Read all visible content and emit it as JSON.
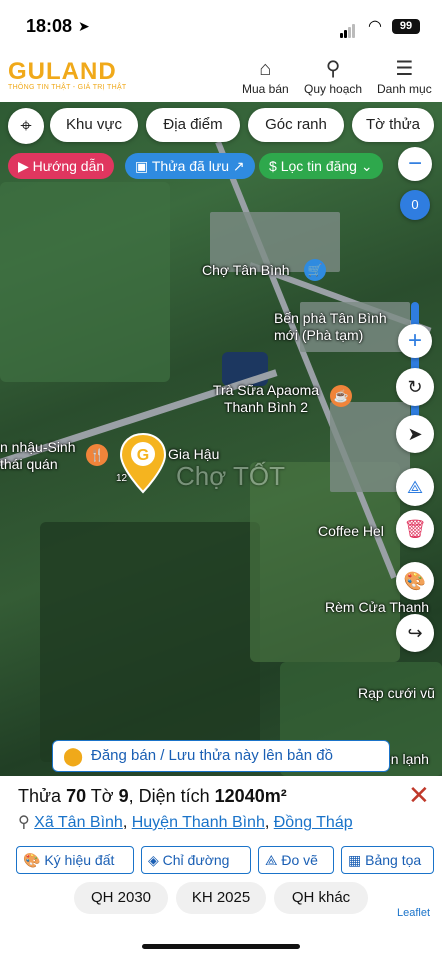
{
  "status_bar": {
    "time": "18:08",
    "battery": "99"
  },
  "header": {
    "logo_text": "GULAND",
    "logo_tagline": "THÔNG TIN THẬT - GIÁ TRỊ THẬT",
    "nav": [
      {
        "label": "Mua bán",
        "icon": "store-icon"
      },
      {
        "label": "Quy hoạch",
        "icon": "map-search-icon"
      },
      {
        "label": "Danh mục",
        "icon": "menu-icon"
      }
    ]
  },
  "filters": [
    "Khu vực",
    "Địa điểm",
    "Góc ranh",
    "Tờ thửa"
  ],
  "tags": {
    "guide": "Hướng dẫn",
    "saved": "Thửa đã lưu",
    "filter": "Lọc tin đăng"
  },
  "zoom_level": "0",
  "map_labels": {
    "market": "Chợ Tân Bình",
    "ferry": "Bến phà Tân Bình mới (Phà tạm)",
    "tea": "Trà Sữa Apaoma Thanh Bình 2",
    "restaurant": "n nhậu-Sinh thái quán",
    "gia_hau": "Gia Hậu",
    "coffee": "Coffee Hel",
    "curtain": "Rèm Cửa Thanh",
    "wedding": "Rạp cưới vũ",
    "ice": "ện lạnh",
    "watermark": "Chợ TỐT",
    "parcel_num": "12"
  },
  "banner": "Đăng bán / Lưu thửa này lên bản đồ",
  "parcel": {
    "title_prefix": "Thửa ",
    "parcel_no": "70",
    "sheet_prefix": " Tờ ",
    "sheet_no": "9",
    "area_prefix": ", Diện tích ",
    "area": "12040m²",
    "commune": "Xã Tân Bình",
    "district": "Huyện Thanh Bình",
    "province": "Đồng Tháp"
  },
  "actions": [
    "Ký hiệu đất",
    "Chỉ đường",
    "Đo vẽ",
    "Bảng tọa"
  ],
  "plans": [
    "QH 2030",
    "KH 2025",
    "QH khác"
  ],
  "attribution": "Leaflet"
}
